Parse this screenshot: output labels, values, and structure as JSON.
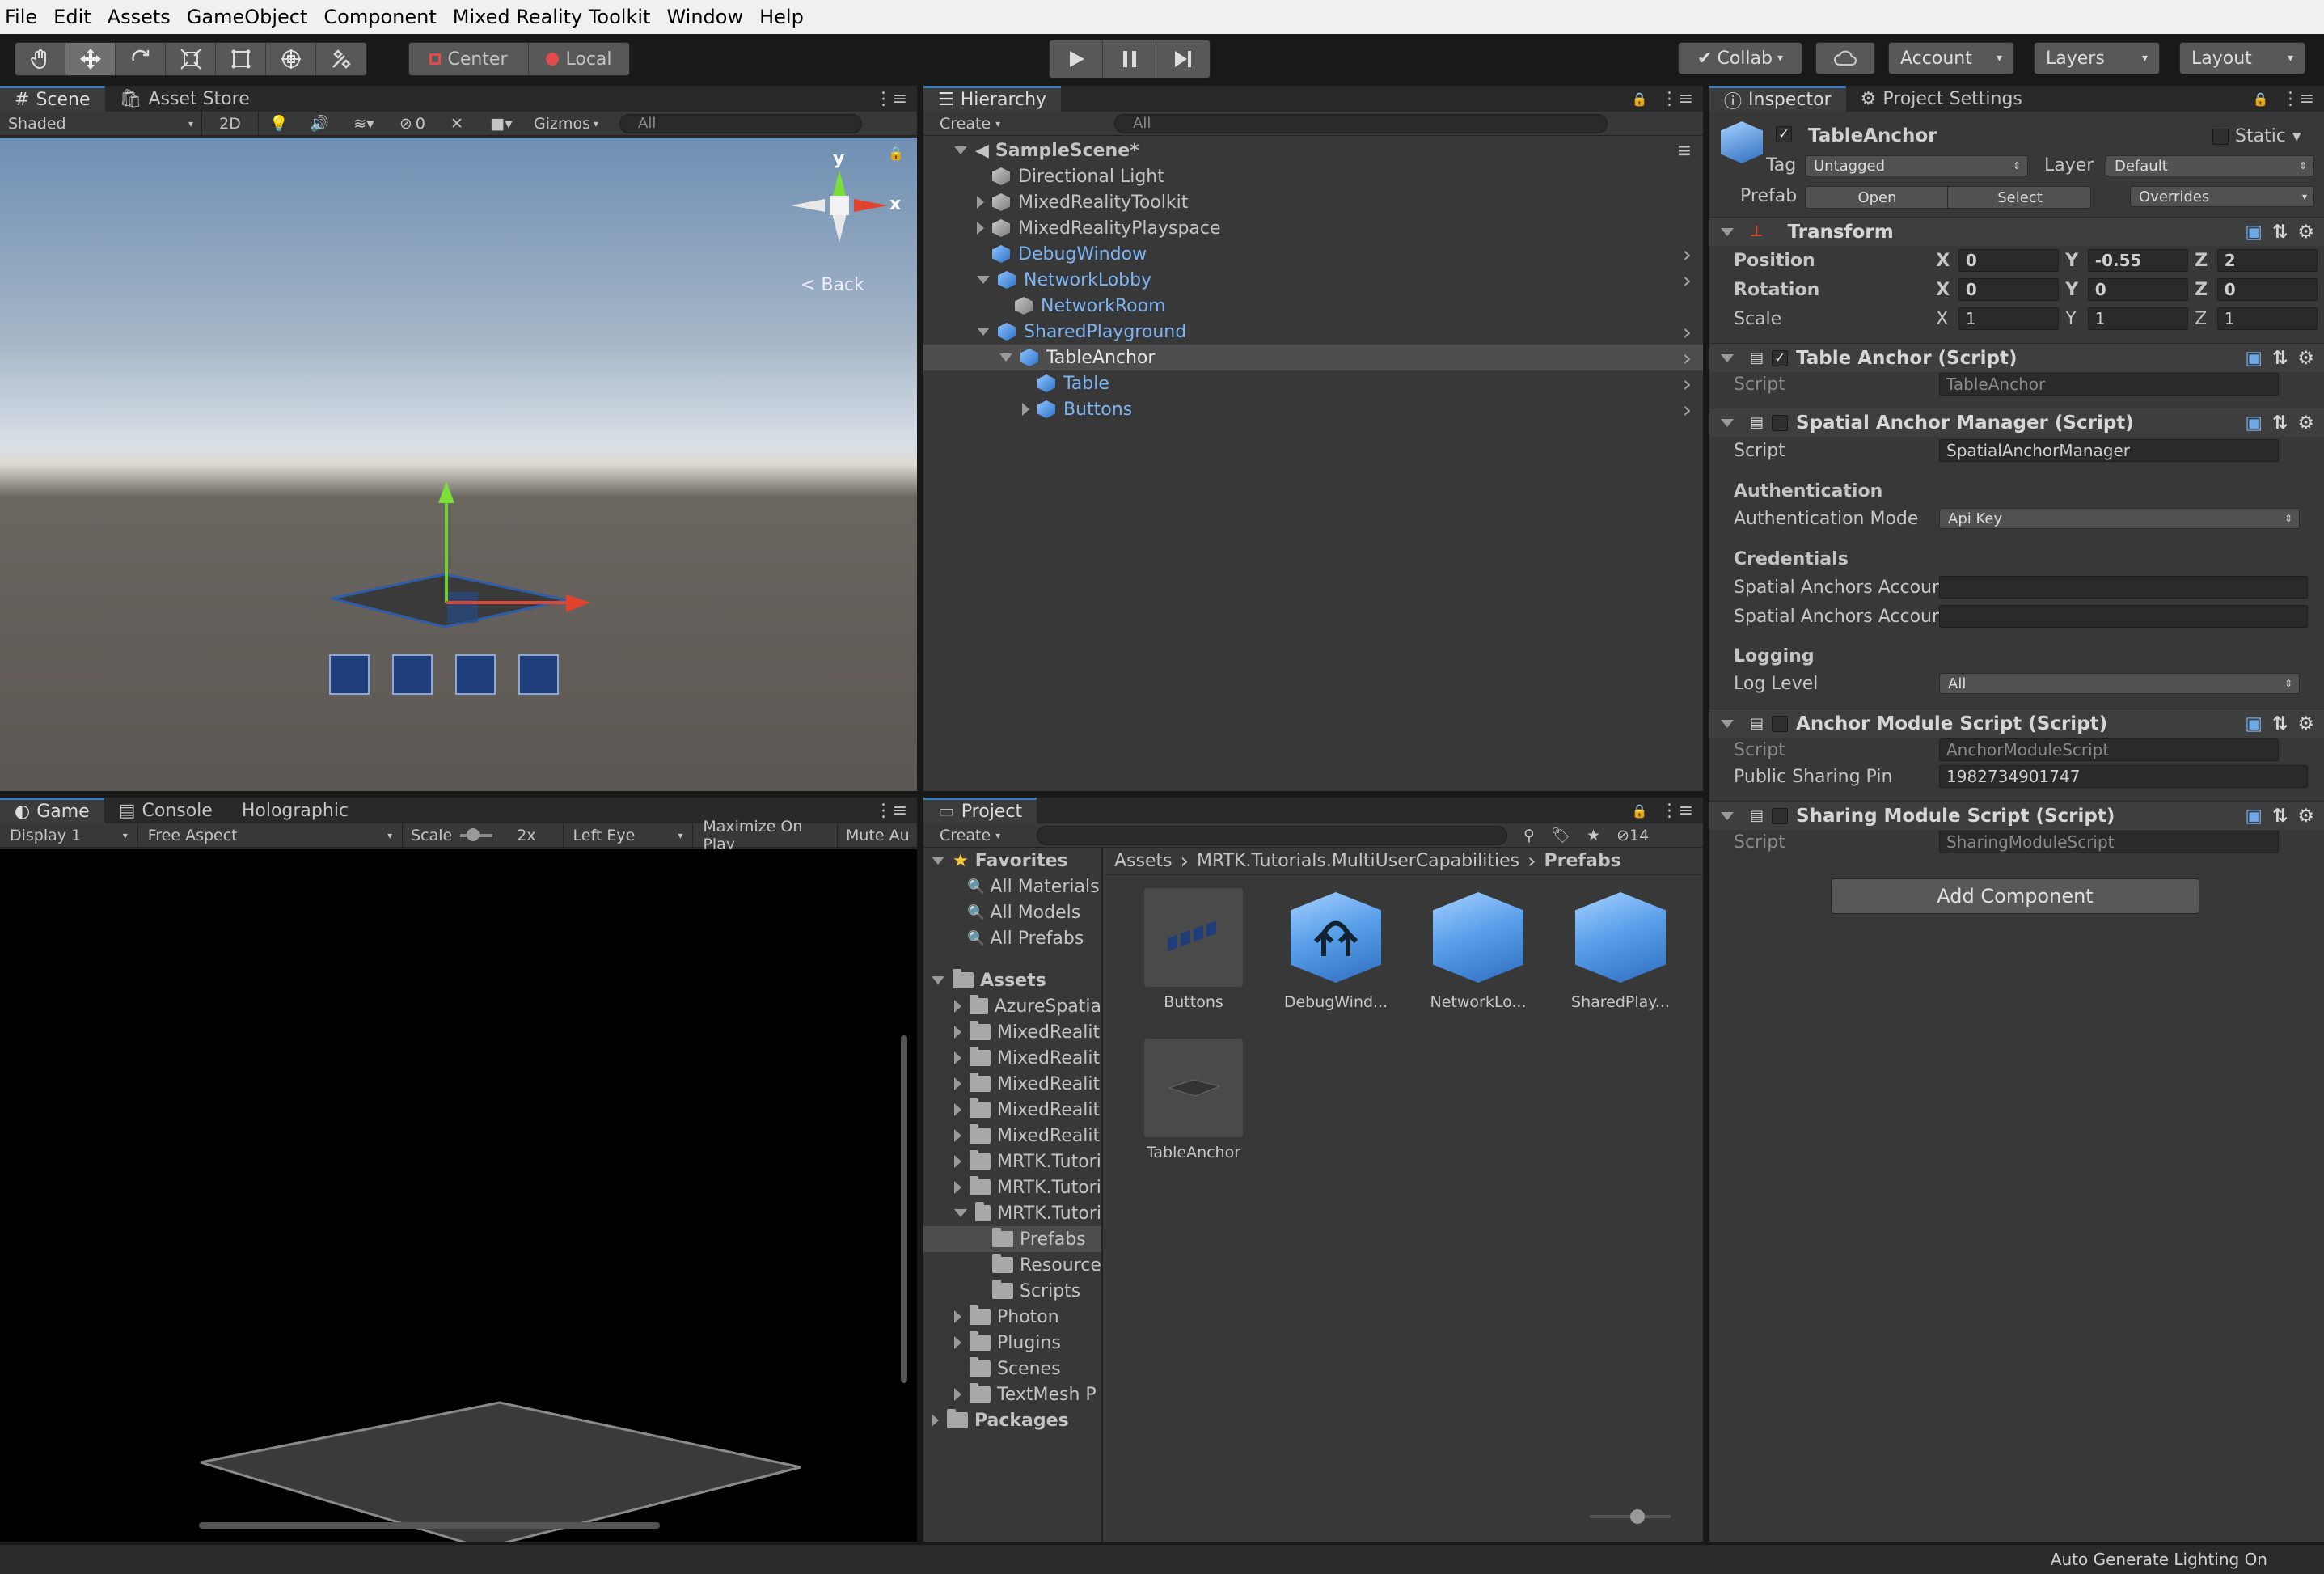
{
  "menubar": {
    "items": [
      "File",
      "Edit",
      "Assets",
      "GameObject",
      "Component",
      "Mixed Reality Toolkit",
      "Window",
      "Help"
    ]
  },
  "toolbar": {
    "pivot_label": "Center",
    "space_label": "Local",
    "collab_label": "Collab",
    "account_label": "Account",
    "layers_label": "Layers",
    "layout_label": "Layout"
  },
  "scene": {
    "tab_scene": "Scene",
    "tab_asset_store": "Asset Store",
    "shading": "Shaded",
    "mode_2d": "2D",
    "hidden_count": "0",
    "gizmos": "Gizmos",
    "search_placeholder": "All",
    "gizmo_y": "y",
    "gizmo_x": "x",
    "back_label": "< Back"
  },
  "game": {
    "tab_game": "Game",
    "tab_console": "Console",
    "tab_holographic": "Holographic",
    "display": "Display 1",
    "aspect": "Free Aspect",
    "scale_label": "Scale",
    "scale_value": "2x",
    "eye": "Left Eye",
    "maximize": "Maximize On Play",
    "mute": "Mute Au"
  },
  "hierarchy": {
    "tab": "Hierarchy",
    "create": "Create",
    "search_placeholder": "All",
    "scene_name": "SampleScene*",
    "items": [
      {
        "label": "Directional Light",
        "indent": 1,
        "expander": "none",
        "color": "normal",
        "prefab": false
      },
      {
        "label": "MixedRealityToolkit",
        "indent": 1,
        "expander": "closed",
        "color": "normal",
        "prefab": false
      },
      {
        "label": "MixedRealityPlayspace",
        "indent": 1,
        "expander": "closed",
        "color": "normal",
        "prefab": false
      },
      {
        "label": "DebugWindow",
        "indent": 1,
        "expander": "none",
        "color": "blue",
        "prefab": true
      },
      {
        "label": "NetworkLobby",
        "indent": 1,
        "expander": "open",
        "color": "blue",
        "prefab": true
      },
      {
        "label": "NetworkRoom",
        "indent": 2,
        "expander": "none",
        "color": "blue",
        "prefab": false
      },
      {
        "label": "SharedPlayground",
        "indent": 1,
        "expander": "open",
        "color": "blue",
        "prefab": true
      },
      {
        "label": "TableAnchor",
        "indent": 2,
        "expander": "open",
        "color": "selected",
        "prefab": true
      },
      {
        "label": "Table",
        "indent": 3,
        "expander": "none",
        "color": "blue",
        "prefab": true
      },
      {
        "label": "Buttons",
        "indent": 3,
        "expander": "closed",
        "color": "blue",
        "prefab": true
      }
    ]
  },
  "project": {
    "tab": "Project",
    "create": "Create",
    "hidden_count": "14",
    "favorites_label": "Favorites",
    "favorites": [
      "All Materials",
      "All Models",
      "All Prefabs"
    ],
    "assets_label": "Assets",
    "assets_tree": [
      {
        "label": "AzureSpatia",
        "indent": 1,
        "expander": "closed"
      },
      {
        "label": "MixedRealit",
        "indent": 1,
        "expander": "closed"
      },
      {
        "label": "MixedRealit",
        "indent": 1,
        "expander": "closed"
      },
      {
        "label": "MixedRealit",
        "indent": 1,
        "expander": "closed"
      },
      {
        "label": "MixedRealit",
        "indent": 1,
        "expander": "closed"
      },
      {
        "label": "MixedRealit",
        "indent": 1,
        "expander": "closed"
      },
      {
        "label": "MRTK.Tutori",
        "indent": 1,
        "expander": "closed"
      },
      {
        "label": "MRTK.Tutori",
        "indent": 1,
        "expander": "closed"
      },
      {
        "label": "MRTK.Tutori",
        "indent": 1,
        "expander": "open"
      },
      {
        "label": "Prefabs",
        "indent": 2,
        "expander": "none",
        "selected": true
      },
      {
        "label": "Resource",
        "indent": 2,
        "expander": "none"
      },
      {
        "label": "Scripts",
        "indent": 2,
        "expander": "none"
      },
      {
        "label": "Photon",
        "indent": 1,
        "expander": "closed"
      },
      {
        "label": "Plugins",
        "indent": 1,
        "expander": "closed"
      },
      {
        "label": "Scenes",
        "indent": 1,
        "expander": "none"
      },
      {
        "label": "TextMesh P",
        "indent": 1,
        "expander": "closed"
      }
    ],
    "packages_label": "Packages",
    "breadcrumb": [
      "Assets",
      "MRTK.Tutorials.MultiUserCapabilities",
      "Prefabs"
    ],
    "assets_grid": [
      {
        "label": "Buttons",
        "kind": "buttons"
      },
      {
        "label": "DebugWind...",
        "kind": "debug"
      },
      {
        "label": "NetworkLo...",
        "kind": "cube"
      },
      {
        "label": "SharedPlay...",
        "kind": "cube"
      },
      {
        "label": "TableAnchor",
        "kind": "table"
      }
    ]
  },
  "inspector": {
    "tab_inspector": "Inspector",
    "tab_project_settings": "Project Settings",
    "object_name": "TableAnchor",
    "static_label": "Static",
    "tag_label": "Tag",
    "tag_value": "Untagged",
    "layer_label": "Layer",
    "layer_value": "Default",
    "prefab_label": "Prefab",
    "prefab_open": "Open",
    "prefab_select": "Select",
    "prefab_overrides": "Overrides",
    "transform": {
      "title": "Transform",
      "position_label": "Position",
      "rotation_label": "Rotation",
      "scale_label": "Scale",
      "axis_x": "X",
      "axis_y": "Y",
      "axis_z": "Z",
      "position": {
        "x": "0",
        "y": "-0.55",
        "z": "2"
      },
      "rotation": {
        "x": "0",
        "y": "0",
        "z": "0"
      },
      "scale": {
        "x": "1",
        "y": "1",
        "z": "1"
      }
    },
    "script_label": "Script",
    "table_anchor": {
      "title": "Table Anchor (Script)",
      "script": "TableAnchor"
    },
    "spatial_anchor_manager": {
      "title": "Spatial Anchor Manager (Script)",
      "script": "SpatialAnchorManager",
      "auth_header": "Authentication",
      "auth_mode_label": "Authentication Mode",
      "auth_mode_value": "Api Key",
      "credentials_header": "Credentials",
      "account_id_label": "Spatial Anchors Account",
      "account_key_label": "Spatial Anchors Account",
      "account_id_value": "",
      "account_key_value": "",
      "logging_header": "Logging",
      "log_level_label": "Log Level",
      "log_level_value": "All"
    },
    "anchor_module": {
      "title": "Anchor Module Script (Script)",
      "script": "AnchorModuleScript",
      "pin_label": "Public Sharing Pin",
      "pin_value": "1982734901747"
    },
    "sharing_module": {
      "title": "Sharing Module Script (Script)",
      "script": "SharingModuleScript"
    },
    "add_component": "Add Component"
  },
  "statusbar": {
    "text": "Auto Generate Lighting On"
  },
  "colors": {
    "accent": "#3a79bb",
    "selection": "#4d4d4d",
    "prefab_blue": "#7cb4f4"
  }
}
